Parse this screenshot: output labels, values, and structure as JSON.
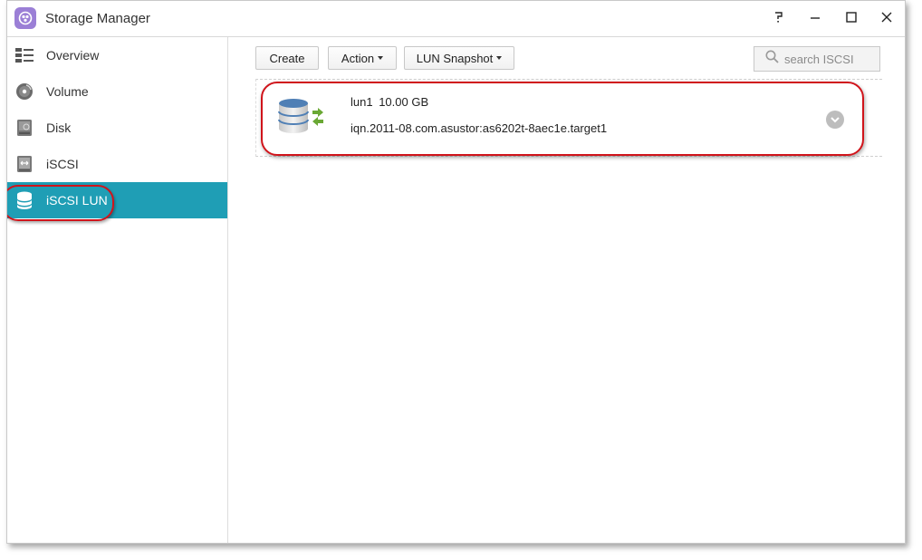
{
  "window": {
    "title": "Storage Manager"
  },
  "window_controls": {
    "help": "?",
    "minimize": "–",
    "maximize": "☐",
    "close": "✕"
  },
  "sidebar": {
    "items": [
      {
        "label": "Overview",
        "icon": "overview-list-icon"
      },
      {
        "label": "Volume",
        "icon": "volume-disc-icon"
      },
      {
        "label": "Disk",
        "icon": "disk-drive-icon"
      },
      {
        "label": "iSCSI",
        "icon": "iscsi-target-icon"
      },
      {
        "label": "iSCSI LUN",
        "icon": "iscsi-lun-database-icon",
        "active": true
      }
    ]
  },
  "toolbar": {
    "create_label": "Create",
    "action_label": "Action",
    "lun_snapshot_label": "LUN Snapshot",
    "search_placeholder": "search ISCSI"
  },
  "luns": [
    {
      "name": "lun1",
      "size": "10.00 GB",
      "iqn": "iqn.2011-08.com.asustor:as6202t-8aec1e.target1",
      "icon": "lun-database-mapped-icon"
    }
  ],
  "colors": {
    "active_nav_bg": "#1f9eb5",
    "highlight_red": "#d0141b",
    "app_icon": "#9b7fd6"
  }
}
